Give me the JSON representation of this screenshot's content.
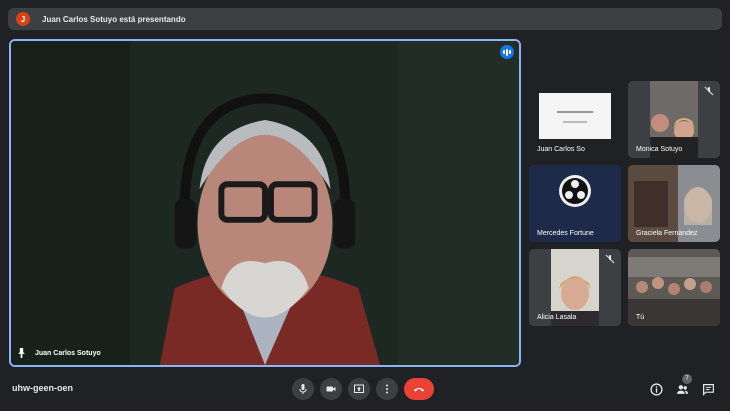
{
  "banner": {
    "avatar_letter": "J",
    "text": "Juan Carlos Sotuyo está presentando"
  },
  "main_video": {
    "participant": "Juan Carlos Sotuyo",
    "speaking_icon": "audio-wave-icon",
    "pin_icon": "pin-icon"
  },
  "tiles": [
    {
      "name": "Juan Carlos So",
      "mic": "on"
    },
    {
      "name": "Monica Sotuyo",
      "mic": "muted"
    },
    {
      "name": "Mercedes Fortune",
      "mic": "on"
    },
    {
      "name": "Graciela Fernandez",
      "mic": "on"
    },
    {
      "name": "Alicia Lasala",
      "mic": "muted"
    },
    {
      "name": "Tú",
      "mic": "on"
    }
  ],
  "meeting_code": "uhw-geen-oen",
  "controls": {
    "mic": "microphone-icon",
    "camera": "camera-icon",
    "present": "present-screen-icon",
    "more": "more-options-icon",
    "end": "end-call-icon"
  },
  "right_controls": {
    "info": "info-icon",
    "people": "people-icon",
    "people_count": "7",
    "chat": "chat-icon"
  },
  "colors": {
    "background": "#202124",
    "surface": "#3c4043",
    "accent": "#8ab4f8",
    "speaking": "#1a73e8",
    "end_call": "#ea4335"
  }
}
